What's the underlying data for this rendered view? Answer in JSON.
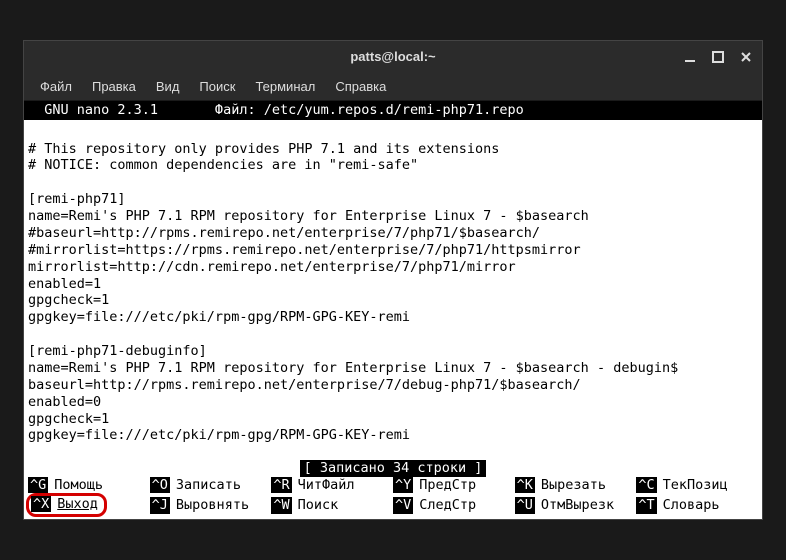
{
  "window": {
    "title": "patts@local:~"
  },
  "menubar": [
    "Файл",
    "Правка",
    "Вид",
    "Поиск",
    "Терминал",
    "Справка"
  ],
  "nano": {
    "header": "  GNU nano 2.3.1       Файл: /etc/yum.repos.d/remi-php71.repo                  ",
    "lines": [
      "",
      "# This repository only provides PHP 7.1 and its extensions",
      "# NOTICE: common dependencies are in \"remi-safe\"",
      "",
      "[remi-php71]",
      "name=Remi's PHP 7.1 RPM repository for Enterprise Linux 7 - $basearch",
      "#baseurl=http://rpms.remirepo.net/enterprise/7/php71/$basearch/",
      "#mirrorlist=https://rpms.remirepo.net/enterprise/7/php71/httpsmirror",
      "mirrorlist=http://cdn.remirepo.net/enterprise/7/php71/mirror",
      "enabled=1",
      "gpgcheck=1",
      "gpgkey=file:///etc/pki/rpm-gpg/RPM-GPG-KEY-remi",
      "",
      "[remi-php71-debuginfo]",
      "name=Remi's PHP 7.1 RPM repository for Enterprise Linux 7 - $basearch - debugin$",
      "baseurl=http://rpms.remirepo.net/enterprise/7/debug-php71/$basearch/",
      "enabled=0",
      "gpgcheck=1",
      "gpgkey=file:///etc/pki/rpm-gpg/RPM-GPG-KEY-remi",
      ""
    ],
    "status": "[ Записано 34 строки ]",
    "shortcuts": [
      {
        "key": "^G",
        "label": "Помощь"
      },
      {
        "key": "^O",
        "label": "Записать"
      },
      {
        "key": "^R",
        "label": "ЧитФайл"
      },
      {
        "key": "^Y",
        "label": "ПредСтр"
      },
      {
        "key": "^K",
        "label": "Вырезать"
      },
      {
        "key": "^C",
        "label": "ТекПозиц"
      },
      {
        "key": "^X",
        "label": "Выход",
        "highlight": true
      },
      {
        "key": "^J",
        "label": "Выровнять"
      },
      {
        "key": "^W",
        "label": "Поиск"
      },
      {
        "key": "^V",
        "label": "СледСтр"
      },
      {
        "key": "^U",
        "label": "ОтмВырезк"
      },
      {
        "key": "^T",
        "label": "Словарь"
      }
    ]
  }
}
